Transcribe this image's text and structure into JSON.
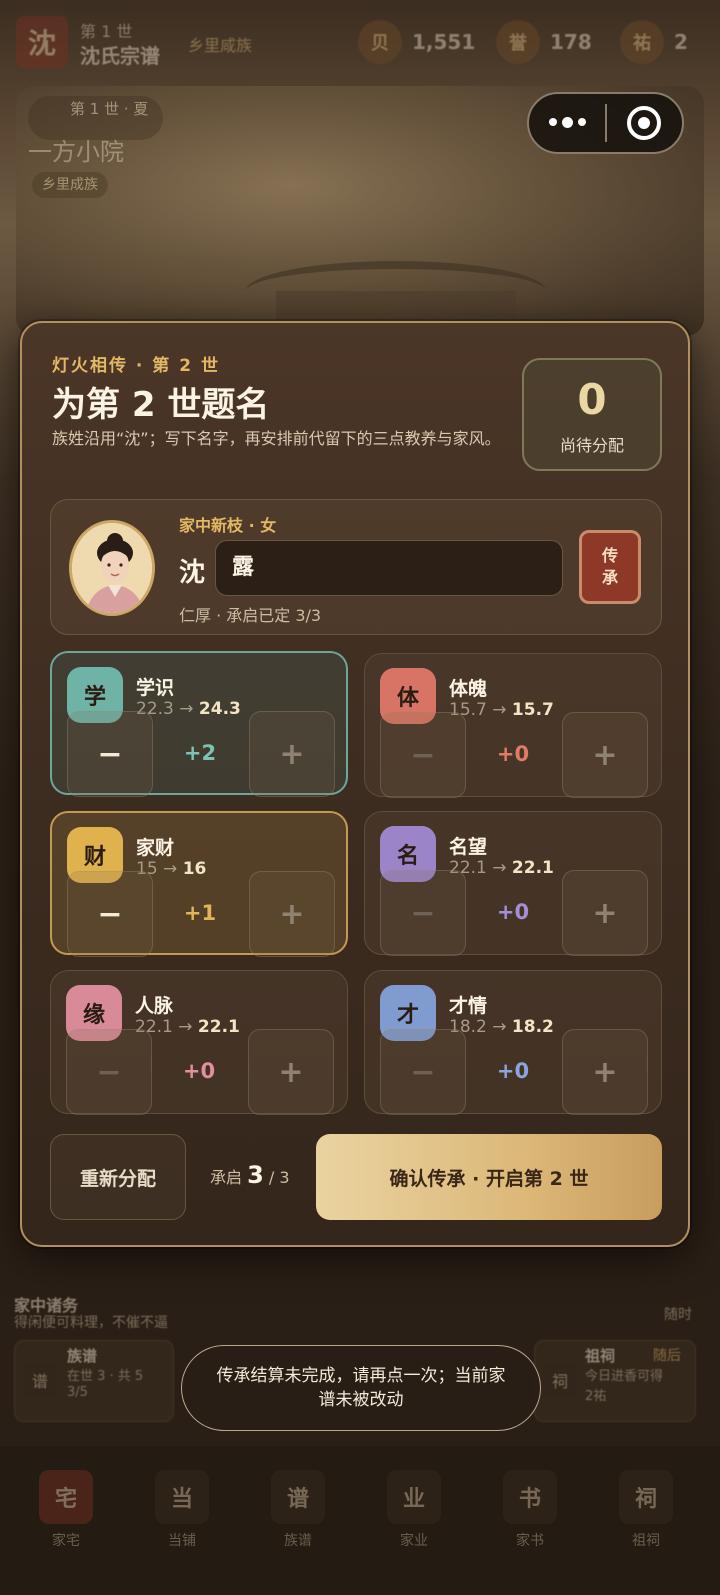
{
  "header": {
    "surname_badge": "沈",
    "generation": "第 1 世",
    "clan_title": "沈氏宗谱",
    "rank": "乡里咸族",
    "stats": [
      {
        "icon": "贝",
        "value": "1,551"
      },
      {
        "icon": "誉",
        "value": "178"
      },
      {
        "icon": "祐",
        "value": "2"
      }
    ]
  },
  "hero": {
    "generation_label": "第 1 世 · 夏",
    "place": "一方小院",
    "rank_tag": "乡里成族"
  },
  "modal": {
    "eyebrow": "灯火相传 · 第 2 世",
    "title": "为第 2 世题名",
    "description": "族姓沿用“沈”；写下名字，再安排前代留下的三点教养与家风。",
    "pending": {
      "value": "0",
      "label": "尚待分配"
    },
    "person": {
      "subtitle": "家中新枝 · 女",
      "surname": "沈",
      "given_name": "露",
      "virtue": "仁厚 · 承启已定 3/3",
      "inherit_line1": "传",
      "inherit_line2": "承"
    },
    "attributes": [
      {
        "badge": "学",
        "name": "学识",
        "from": "22.3",
        "to": "24.3",
        "delta": "+2",
        "color": "#6fb3a6",
        "delta_color": "#7ec2b4"
      },
      {
        "badge": "体",
        "name": "体魄",
        "from": "15.7",
        "to": "15.7",
        "delta": "+0",
        "color": "#d87466",
        "delta_color": "#e07c66"
      },
      {
        "badge": "财",
        "name": "家财",
        "from": "15",
        "to": "16",
        "delta": "+1",
        "color": "#e0b24e",
        "delta_color": "#e2b45c"
      },
      {
        "badge": "名",
        "name": "名望",
        "from": "22.1",
        "to": "22.1",
        "delta": "+0",
        "color": "#9b85c8",
        "delta_color": "#a58fd4"
      },
      {
        "badge": "缘",
        "name": "人脉",
        "from": "22.1",
        "to": "22.1",
        "delta": "+0",
        "color": "#d88a98",
        "delta_color": "#e08fa0"
      },
      {
        "badge": "才",
        "name": "才情",
        "from": "18.2",
        "to": "18.2",
        "delta": "+0",
        "color": "#7f9bd0",
        "delta_color": "#8aa5dc"
      }
    ],
    "minus_label": "−",
    "plus_label": "+",
    "arrow": "→",
    "reset_label": "重新分配",
    "quota_prefix": "承启",
    "quota_value": "3",
    "quota_total": "/ 3",
    "confirm_label": "确认传承 · 开启第 2 世"
  },
  "background": {
    "affairs_title": "家中诸务",
    "affairs_desc": "得闲便可料理，不催不逼",
    "affairs_right": "随时",
    "genealogy_card": {
      "icon": "谱",
      "title": "族谱",
      "desc": "在世 3 · 共 5",
      "sub": "3/5"
    },
    "shrine_card": {
      "icon": "祠",
      "title": "祖祠",
      "tag": "随后",
      "desc": "今日进香可得",
      "sub": "2祐"
    }
  },
  "nav": [
    {
      "icon": "宅",
      "label": "家宅"
    },
    {
      "icon": "当",
      "label": "当铺"
    },
    {
      "icon": "谱",
      "label": "族谱"
    },
    {
      "icon": "业",
      "label": "家业"
    },
    {
      "icon": "书",
      "label": "家书"
    },
    {
      "icon": "祠",
      "label": "祖祠"
    }
  ],
  "toast": "传承结算未完成，请再点一次；当前家谱未被改动"
}
